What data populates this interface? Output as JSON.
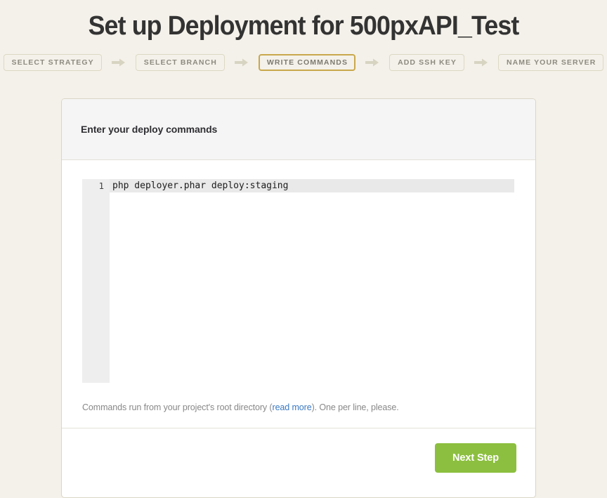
{
  "page": {
    "title": "Set up Deployment for 500pxAPI_Test",
    "background_color": "#f4f1ea"
  },
  "steps": {
    "items": [
      {
        "label": "Select Strategy",
        "active": false
      },
      {
        "label": "Select Branch",
        "active": false
      },
      {
        "label": "Write Commands",
        "active": true
      },
      {
        "label": "Add SSH Key",
        "active": false
      },
      {
        "label": "Name your server",
        "active": false
      }
    ],
    "arrow_icon": "arrow-right-icon",
    "active_border_color": "#c9a84c",
    "inactive_border_color": "#ddd8c4",
    "arrow_color": "#d8d4c2"
  },
  "card": {
    "header_title": "Enter your deploy commands",
    "editor": {
      "lines": [
        {
          "number": "1",
          "text": "php deployer.phar deploy:staging",
          "active": true
        }
      ],
      "gutter_numbers": [
        "1"
      ],
      "active_line_color": "#e9e9e9",
      "gutter_color": "#eeeeee"
    },
    "helper": {
      "text_before": "Commands run from your project's root directory (",
      "link_label": "read more",
      "text_after": "). One per line, please."
    },
    "footer": {
      "next_label": "Next Step",
      "next_color": "#8cbf3f"
    }
  }
}
